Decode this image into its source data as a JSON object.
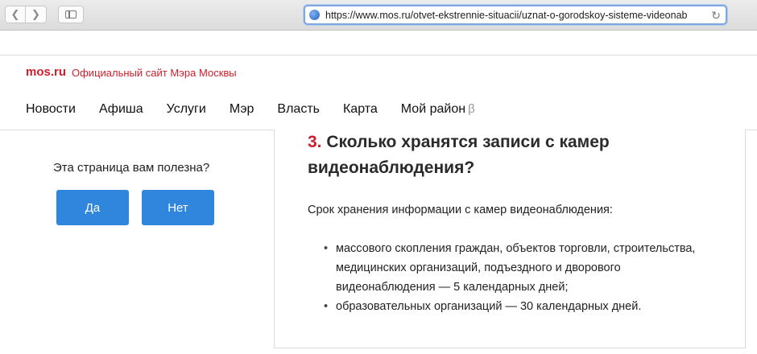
{
  "browser": {
    "url": "https://www.mos.ru/otvet-ekstrennie-situacii/uznat-o-gorodskoy-sisteme-videonab"
  },
  "header": {
    "logo": "mos.ru",
    "subtitle": "Официальный сайт Мэра Москвы",
    "nav": [
      "Новости",
      "Афиша",
      "Услуги",
      "Мэр",
      "Власть",
      "Карта",
      "Мой район"
    ],
    "beta": "β"
  },
  "feedback": {
    "question": "Эта страница вам полезна?",
    "yes": "Да",
    "no": "Нет"
  },
  "article": {
    "number": "3.",
    "title": "Сколько хранятся записи с камер видеонаблюдения?",
    "lead": "Срок хранения информации с камер видеонаблюдения:",
    "bullets": [
      "массового скопления граждан, объектов торговли, строительства, медицинских организаций, подъездного и дворового видеонаблюдения — 5 календарных дней;",
      "образовательных организаций — 30 календарных дней."
    ]
  }
}
